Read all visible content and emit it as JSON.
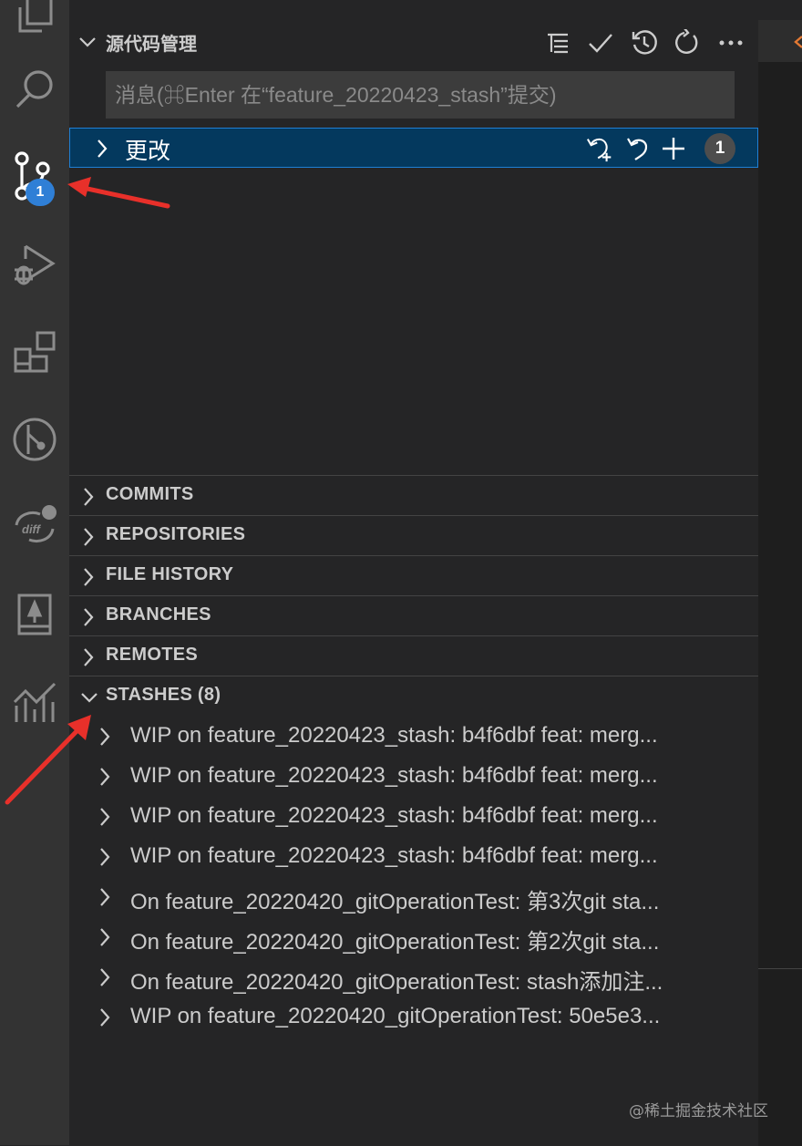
{
  "activity_bar": {
    "icons": [
      "explorer-icon",
      "search-icon",
      "source-control-icon",
      "run-debug-icon",
      "extensions-icon",
      "git-graph-icon",
      "git-diff-icon",
      "book-icon",
      "chart-icon"
    ],
    "source_control_badge": "1"
  },
  "sidebar": {
    "title": "源代码管理",
    "toolbar": [
      "tree-view-icon",
      "commit-check-icon",
      "history-icon",
      "refresh-icon",
      "more-icon"
    ],
    "commit_input": {
      "placeholder": "消息(⌘Enter 在“feature_20220423_stash”提交)",
      "value": ""
    },
    "changes": {
      "label": "更改",
      "count": "1"
    },
    "sections": [
      {
        "label": "COMMITS",
        "expanded": false
      },
      {
        "label": "REPOSITORIES",
        "expanded": false
      },
      {
        "label": "FILE HISTORY",
        "expanded": false
      },
      {
        "label": "BRANCHES",
        "expanded": false
      },
      {
        "label": "REMOTES",
        "expanded": false
      },
      {
        "label": "STASHES (8)",
        "expanded": true
      }
    ],
    "stashes": [
      "WIP on feature_20220423_stash: b4f6dbf feat: merg...",
      "WIP on feature_20220423_stash: b4f6dbf feat: merg...",
      "WIP on feature_20220423_stash: b4f6dbf feat: merg...",
      "WIP on feature_20220423_stash: b4f6dbf feat: merg...",
      "On feature_20220420_gitOperationTest: 第3次git sta...",
      "On feature_20220420_gitOperationTest: 第2次git sta...",
      "On feature_20220420_gitOperationTest: stash添加注...",
      "WIP on feature_20220420_gitOperationTest: 50e5e3..."
    ]
  },
  "colors": {
    "accent": "#2f7fd6",
    "selection_bg": "#04395e",
    "annotation_arrow": "#e8302a"
  },
  "watermark": "@稀土掘金技术社区"
}
